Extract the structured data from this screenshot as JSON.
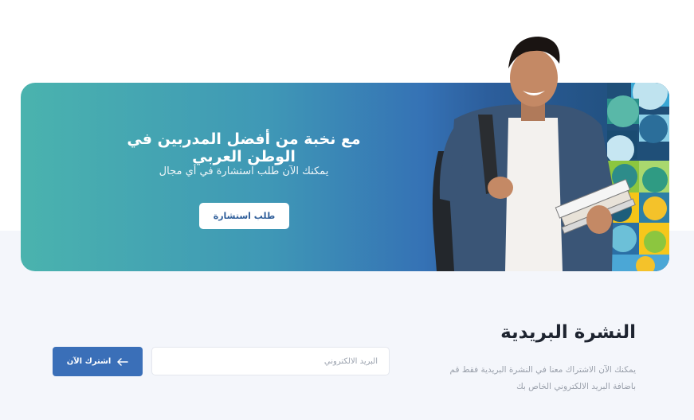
{
  "banner": {
    "title": "مع نخبة من أفضل المدربين في الوطن العربي",
    "subtitle": "يمكنك الآن طلب استشارة في أي مجال",
    "button_label": "طلب استشارة"
  },
  "newsletter": {
    "title": "النشرة البريدية",
    "description": "يمكنك الآن الاشتراك معنا في النشرة البريدية فقط قم باضافة البريد الالكتروني الخاص بك",
    "email_placeholder": "البريد الالكتروني",
    "subscribe_label": "اشترك الآن",
    "subscribe_icon": "arrow-left-icon"
  },
  "colors": {
    "gradient_start": "#4ab3ae",
    "gradient_end": "#1d4b74",
    "primary_button": "#3a6fb8",
    "section_bg": "#f4f6fb"
  }
}
